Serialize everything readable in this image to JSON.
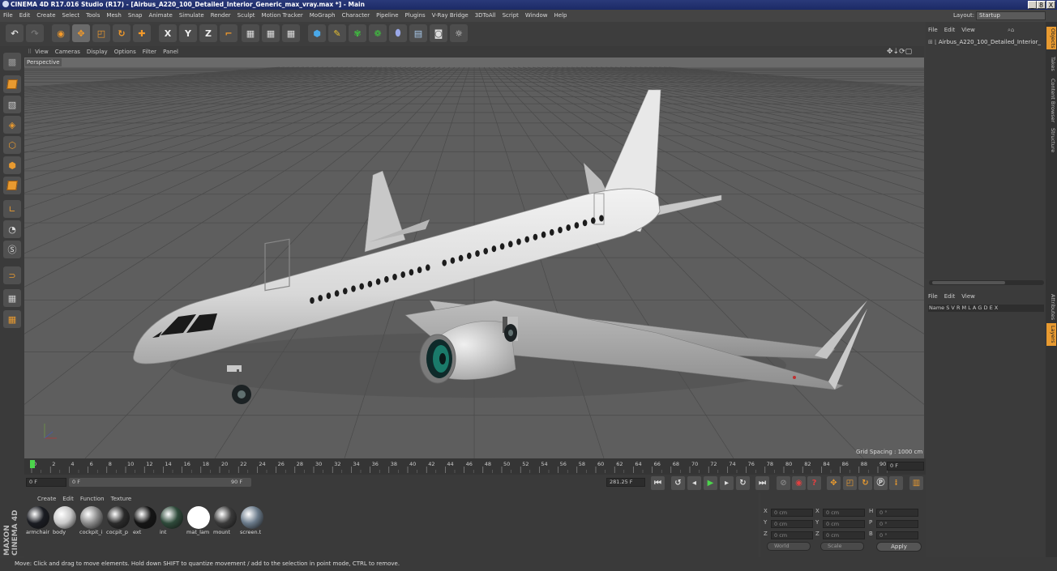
{
  "title": "CINEMA 4D R17.016 Studio (R17) - [Airbus_A220_100_Detailed_Interior_Generic_max_vray.max *] - Main",
  "window_buttons": [
    "_",
    "8",
    "X"
  ],
  "menu": [
    "File",
    "Edit",
    "Create",
    "Select",
    "Tools",
    "Mesh",
    "Snap",
    "Animate",
    "Simulate",
    "Render",
    "Sculpt",
    "Motion Tracker",
    "MoGraph",
    "Character",
    "Pipeline",
    "Plugins",
    "V-Ray Bridge",
    "3DToAll",
    "Script",
    "Window",
    "Help"
  ],
  "layout": {
    "label": "Layout:",
    "value": "Startup"
  },
  "axis_buttons": [
    "X",
    "Y",
    "Z"
  ],
  "viewport": {
    "menu": [
      "View",
      "Cameras",
      "Display",
      "Options",
      "Filter",
      "Panel"
    ],
    "label": "Perspective",
    "grid_spacing": "Grid Spacing : 1000 cm"
  },
  "timeline": {
    "ticks": [
      "0",
      "2",
      "4",
      "6",
      "8",
      "10",
      "12",
      "14",
      "16",
      "18",
      "20",
      "22",
      "24",
      "26",
      "28",
      "30",
      "32",
      "34",
      "36",
      "38",
      "40",
      "42",
      "44",
      "46",
      "48",
      "50",
      "52",
      "54",
      "56",
      "58",
      "60",
      "62",
      "64",
      "66",
      "68",
      "70",
      "72",
      "74",
      "76",
      "78",
      "80",
      "82",
      "84",
      "86",
      "88",
      "90"
    ],
    "current_frame": "0 F",
    "start": "0 F",
    "slider_start": "0 F",
    "slider_end": "90 F",
    "fps_value": "281.25 F"
  },
  "materials": {
    "menu": [
      "Create",
      "Edit",
      "Function",
      "Texture"
    ],
    "items": [
      {
        "name": "armchair",
        "color": "#1a1c22"
      },
      {
        "name": "body",
        "color": "#c8c8c8"
      },
      {
        "name": "cockpit_i",
        "color": "#8a8a8a"
      },
      {
        "name": "cocpit_p",
        "color": "#2a2a2a"
      },
      {
        "name": "ext",
        "color": "#141414"
      },
      {
        "name": "int",
        "color": "#2e4a3a"
      },
      {
        "name": "mat_lam",
        "color": "#ffffff"
      },
      {
        "name": "mount",
        "color": "#3a3a3a"
      },
      {
        "name": "screen.t",
        "color": "#6a7a8a"
      }
    ]
  },
  "brand": "MAXON CINEMA 4D",
  "coords": {
    "rows": [
      {
        "a": "X",
        "av": "0 cm",
        "b": "X",
        "bv": "0 cm",
        "c": "H",
        "cv": "0 °"
      },
      {
        "a": "Y",
        "av": "0 cm",
        "b": "Y",
        "bv": "0 cm",
        "c": "P",
        "cv": "0 °"
      },
      {
        "a": "Z",
        "av": "0 cm",
        "b": "Z",
        "bv": "0 cm",
        "c": "B",
        "cv": "0 °"
      }
    ],
    "space": "World",
    "mode": "Scale",
    "apply": "Apply"
  },
  "status": "Move: Click and drag to move elements. Hold down SHIFT to quantize movement / add to the selection in point mode, CTRL to remove.",
  "objects": {
    "menu": [
      "File",
      "Edit",
      "View"
    ],
    "item": "Airbus_A220_100_Detailed_Interior_"
  },
  "layers": {
    "menu": [
      "File",
      "Edit",
      "View"
    ],
    "columns": "Name        S V R M L A G D E X"
  },
  "side_tabs": [
    "Objects",
    "Takes",
    "Content Browser",
    "Structure",
    "Attributes",
    "Layers"
  ]
}
